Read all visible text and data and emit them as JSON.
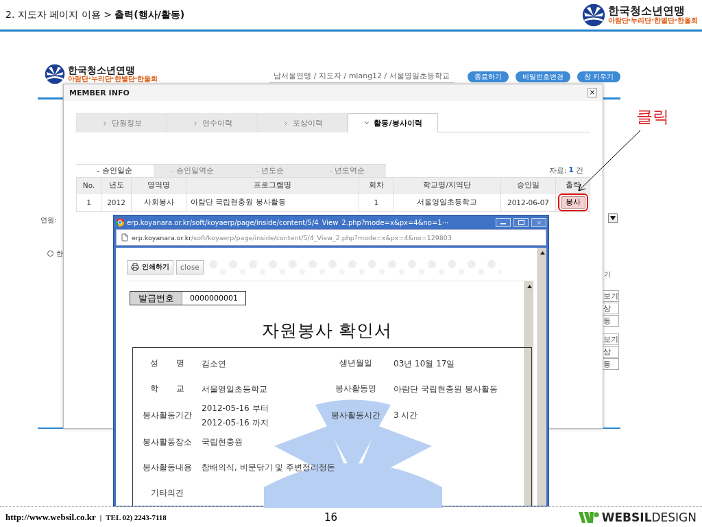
{
  "slide": {
    "breadcrumb": "2. 지도자 페이지 이용 > **출력(행사/활동)**",
    "logo": {
      "name": "한국청소년연맹",
      "subtitle": "아람단·누리단·한별단·한울회"
    }
  },
  "site": {
    "logo": {
      "name": "한국청소년연맹",
      "subtitle": "아람단·누리단·한별단·한울회"
    },
    "breadcrumb": "남서울연맹 / 지도자 / mlang12 / 서울영일초등학교",
    "buttons": [
      "종료하기",
      "비밀번호변경",
      "창 키우기"
    ],
    "field_label": "연원:",
    "radio_selected": false,
    "radio_label": "한",
    "column_heading": "기",
    "row_buttons": [
      [
        "보기",
        "상",
        "동"
      ],
      [
        "보기",
        "상",
        "동"
      ]
    ]
  },
  "modal": {
    "title": "MEMBER INFO",
    "close": "×",
    "tabs": [
      {
        "label": "단원정보",
        "selected": false
      },
      {
        "label": "연수이력",
        "selected": false
      },
      {
        "label": "포상이력",
        "selected": false
      },
      {
        "label": "활동/봉사이력",
        "selected": true
      }
    ],
    "sort_tabs": [
      {
        "label": "승인일순",
        "selected": true
      },
      {
        "label": "승인일역순",
        "selected": false
      },
      {
        "label": "년도순",
        "selected": false
      },
      {
        "label": "년도역순",
        "selected": false
      }
    ],
    "count_label": "자료:",
    "count": "1",
    "count_unit": "건",
    "table": {
      "columns": [
        "No.",
        "년도",
        "영역명",
        "프로그램명",
        "회차",
        "학교명/지역단",
        "승인일",
        "출력"
      ],
      "rows": [
        {
          "cells": [
            "1",
            "2012",
            "사회봉사",
            "아람단 국립현충원 봉사활동",
            "1",
            "서울영일초등학교",
            "2012-06-07"
          ],
          "button": "봉사",
          "highlighted": true
        }
      ]
    }
  },
  "popup": {
    "title": "erp.koyanara.or.kr/soft/koyaerp/page/inside/content/5/4_View_2.php?mode=x&px=4&no=1···",
    "address_host": "erp.koyanara.or.kr",
    "address_path": "/soft/koyaerp/page/inside/content/5/4_View_2.php?mode=x&px=4&no=129803",
    "print_button": "인쇄하기",
    "close_button": "close",
    "issue_label": "발급번호",
    "issue_number": "0000000001",
    "document_title": "자원봉사 확인서",
    "rows": [
      {
        "cells": [
          {
            "label": "성 명",
            "value": [
              "김소연"
            ]
          },
          {
            "label": "생년월일",
            "value": [
              "03년 10월 17일"
            ]
          }
        ]
      },
      {
        "cells": [
          {
            "label": "학 교",
            "value": [
              "서울영일초등학교"
            ]
          },
          {
            "label": "봉사활동명",
            "value": [
              "아람단 국립현충원 봉사활동"
            ]
          }
        ]
      },
      {
        "cells": [
          {
            "label": "봉사활동기간",
            "value": [
              "2012-05-16 부터",
              "2012-05-16 까지"
            ]
          },
          {
            "label": "봉사활동시간",
            "value": [
              "3 시간"
            ]
          }
        ]
      },
      {
        "cells": [
          {
            "label": "봉사활동장소",
            "value": [
              "국립현충원"
            ]
          }
        ]
      },
      {
        "cells": [
          {
            "label": "봉사활동내용",
            "value": [
              "참배의식, 비문닦기 및 주변정리정돈"
            ]
          }
        ]
      },
      {
        "cells": [
          {
            "label": "기타의견"
          }
        ]
      }
    ]
  },
  "callout": {
    "text": "클릭"
  },
  "footer": {
    "url": "http://www.websil.co.kr",
    "separator": "|",
    "tel": "TEL 02) 2243-7118",
    "page": "16",
    "brand": "**WEBSIL**DESIGN"
  }
}
